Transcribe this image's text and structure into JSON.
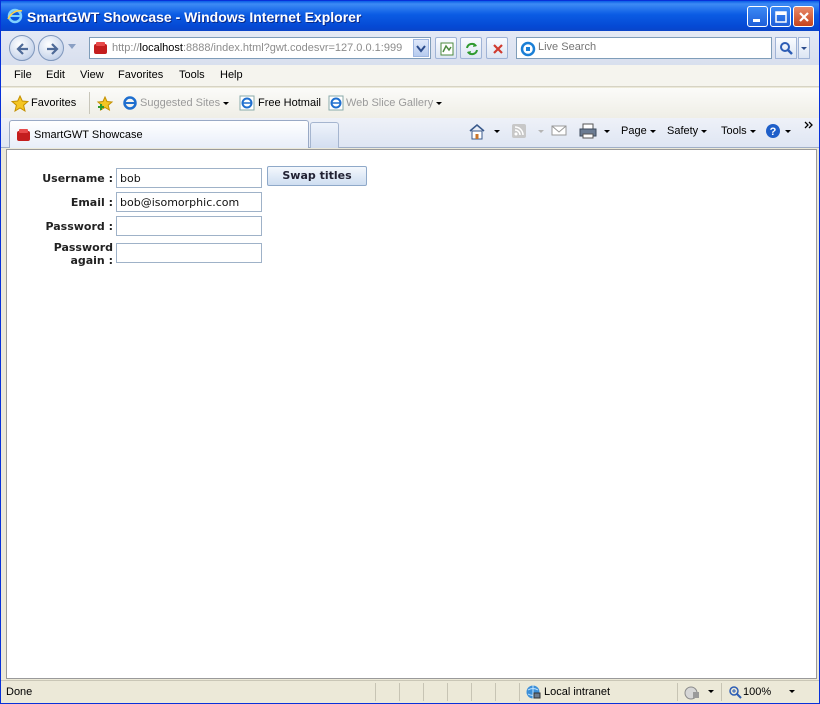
{
  "window": {
    "title": "SmartGWT Showcase - Windows Internet Explorer",
    "app_icon": "ie-icon"
  },
  "address_bar": {
    "url_prefix": "http://",
    "url_host": "localhost",
    "url_rest": ":8888/index.html?gwt.codesvr=127.0.0.1:999",
    "site_icon": "smartgwt-icon"
  },
  "search": {
    "placeholder": "Live Search"
  },
  "menu": {
    "items": [
      "File",
      "Edit",
      "View",
      "Favorites",
      "Tools",
      "Help"
    ]
  },
  "favorites_bar": {
    "favorites_label": "Favorites",
    "suggested_sites": "Suggested Sites",
    "free_hotmail": "Free Hotmail",
    "web_slice_gallery": "Web Slice Gallery"
  },
  "tabs": {
    "active_tab_label": "SmartGWT Showcase"
  },
  "command_bar": {
    "page": "Page",
    "safety": "Safety",
    "tools": "Tools"
  },
  "form": {
    "username_label": "Username :",
    "username_value": "bob",
    "email_label": "Email :",
    "email_value": "bob@isomorphic.com",
    "password_label": "Password :",
    "password_value": "",
    "password_again_label_line1": "Password",
    "password_again_label_line2": "again :",
    "password_again_value": "",
    "swap_button_label": "Swap titles"
  },
  "status_bar": {
    "status_text": "Done",
    "zone": "Local intranet",
    "zoom": "100%"
  },
  "colors": {
    "titlebar": "#0b5ce4",
    "content_bg": "#ffffff",
    "chrome_bg": "#ece9d8"
  }
}
